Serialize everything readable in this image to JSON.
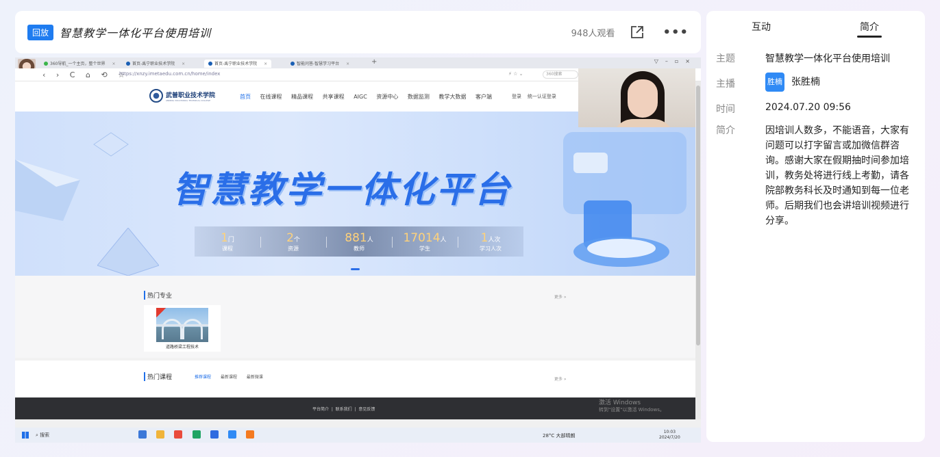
{
  "header": {
    "badge": "回放",
    "title": "智慧教学一体化平台使用培训",
    "viewers": "948人观看",
    "more": "•••"
  },
  "browser": {
    "tabs": [
      {
        "label": "360导航_一个主页，整个世界",
        "color": "#3bb54a"
      },
      {
        "label": "首页-禹宁职业技术学院",
        "color": "#1a5fb4"
      },
      {
        "label": "首页-禹宁职业技术学院",
        "color": "#1a5fb4"
      },
      {
        "label": "智能问答-智慧学习平台",
        "color": "#1a5fb4"
      }
    ],
    "new_tab": "+",
    "nav": "‹ › C ⌂ ⟲ ☆",
    "url": "https://xnzy.imetaedu.com.cn/home/index",
    "search": "360搜索"
  },
  "site": {
    "logo_text": "武普职业技术学院",
    "logo_sub": "ANNING VOCATIONAL TECHNICAL COLLEGE",
    "nav": [
      "首页",
      "在线课程",
      "精品课程",
      "共享课程",
      "AIGC",
      "资源中心",
      "数据监测",
      "教学大数据",
      "客户端"
    ],
    "login": "登录",
    "sso": "统一认证登录",
    "banner_title": "智慧教学一体化平台",
    "stats": [
      {
        "num": "1",
        "unit": "门",
        "label": "课程"
      },
      {
        "num": "2",
        "unit": "个",
        "label": "资源"
      },
      {
        "num": "881",
        "unit": "人",
        "label": "教师"
      },
      {
        "num": "17014",
        "unit": "人",
        "label": "学生"
      },
      {
        "num": "1",
        "unit": "人次",
        "label": "学习人次"
      }
    ],
    "hot_major": "热门专业",
    "more": "更多 »",
    "course_name": "道路桥梁工程技术",
    "hot_course": "热门课程",
    "course_tabs": [
      "推荐课程",
      "最新课程",
      "最新微课"
    ],
    "footer": [
      "平台简介",
      "联系我们",
      "意见反馈"
    ],
    "activate": "激活 Windows",
    "activate_sub": "转到\"设置\"以激活 Windows。"
  },
  "taskbar": {
    "search": "搜索",
    "weather": "28°C 大部晴朗",
    "time": "10:03",
    "date": "2024/7/20"
  },
  "panel": {
    "tabs": [
      "互动",
      "简介"
    ],
    "active_tab": "简介",
    "topic_key": "主题",
    "topic_val": "智慧教学一体化平台使用培训",
    "host_key": "主播",
    "host_badge": "胜楠",
    "host_name": "张胜楠",
    "time_key": "时间",
    "time_val": "2024.07.20 09:56",
    "intro_key": "简介",
    "intro_val": "因培训人数多，不能语音，大家有问题可以打字留言或加微信群咨询。感谢大家在假期抽时间参加培训，教务处将进行线上考勤，请各院部教务科长及时通知到每一位老师。后期我们也会讲培训视频进行分享。"
  },
  "colors": {
    "accent": "#1f7cf0",
    "banner_text": "#2a6ee8",
    "stat_number": "#ffd27a"
  }
}
